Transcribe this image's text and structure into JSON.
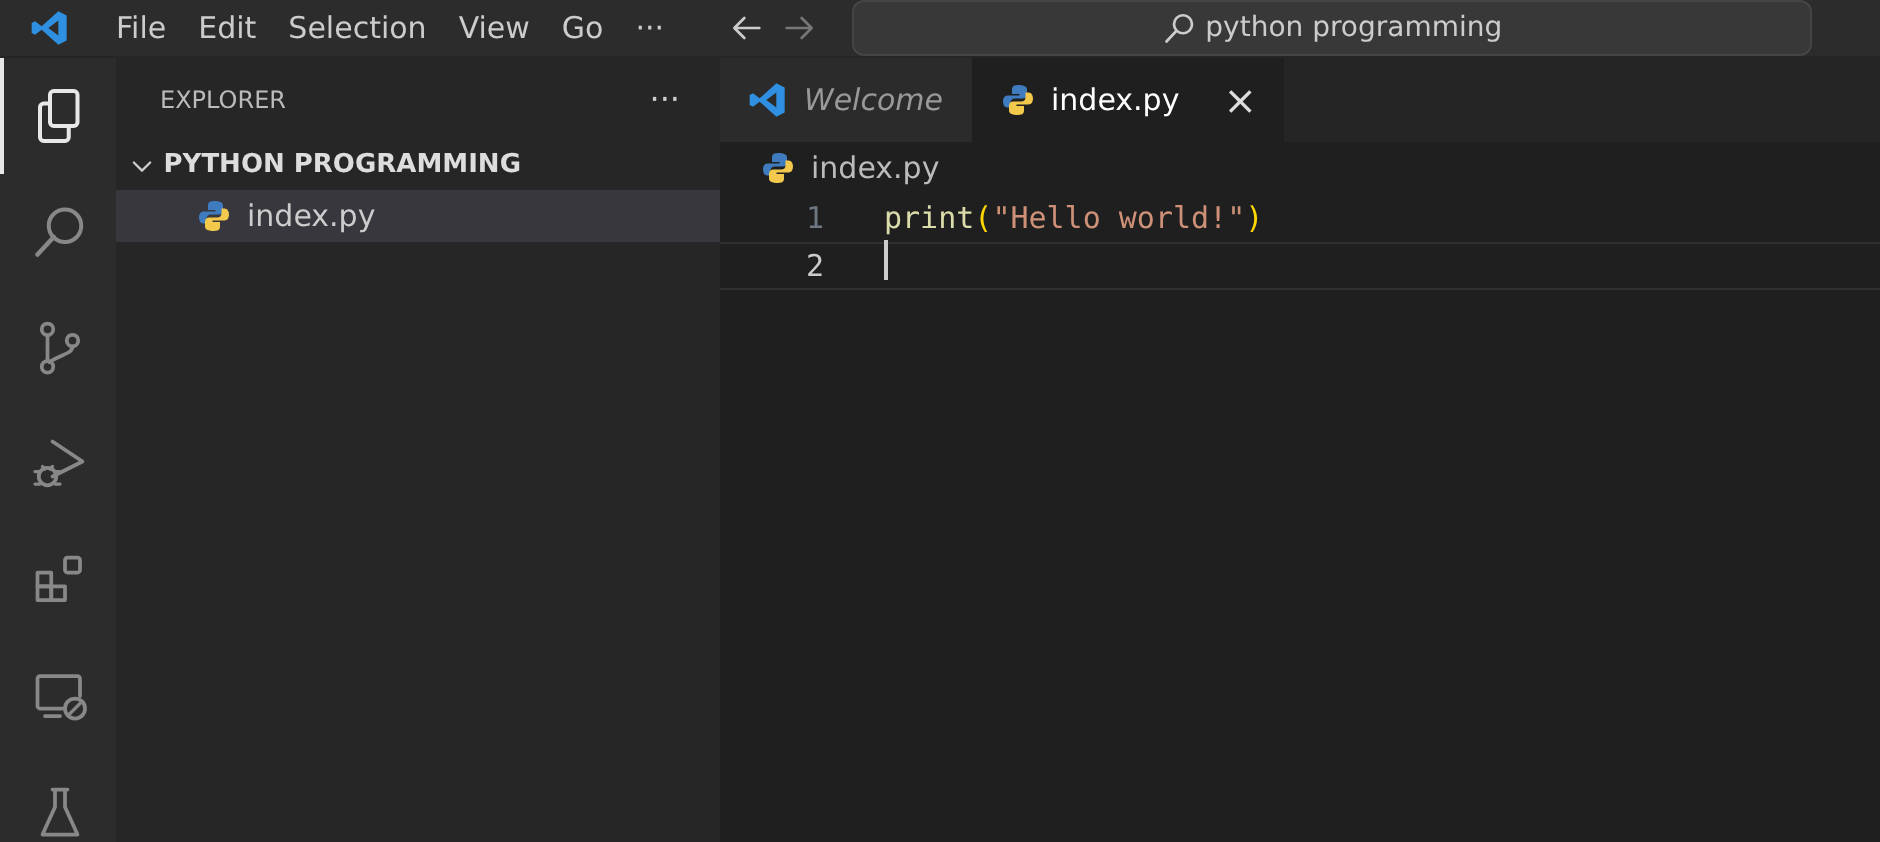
{
  "title_bar": {
    "menu": [
      {
        "label": "File"
      },
      {
        "label": "Edit"
      },
      {
        "label": "Selection"
      },
      {
        "label": "View"
      },
      {
        "label": "Go"
      },
      {
        "label": "···"
      }
    ],
    "search": {
      "value": "python programming"
    }
  },
  "activity_bar": [
    {
      "kind": "explorer",
      "selected": true
    },
    {
      "kind": "search",
      "selected": false
    },
    {
      "kind": "source-control",
      "selected": false
    },
    {
      "kind": "run-debug",
      "selected": false
    },
    {
      "kind": "extensions",
      "selected": false
    },
    {
      "kind": "remote",
      "selected": false
    },
    {
      "kind": "testing",
      "selected": false
    }
  ],
  "sidebar": {
    "title": "EXPLORER",
    "more": "···",
    "folder": {
      "label": "PYTHON PROGRAMMING",
      "expanded": true,
      "children": [
        {
          "label": "index.py",
          "kind": "python",
          "selected": true
        }
      ]
    }
  },
  "tabs": [
    {
      "label": "Welcome",
      "kind": "vscode",
      "preview": true,
      "selected": false
    },
    {
      "label": "index.py",
      "kind": "python",
      "preview": false,
      "selected": true,
      "close": "×"
    }
  ],
  "breadcrumb": {
    "label": "index.py",
    "kind": "python"
  },
  "code_lines": [
    {
      "number": "1",
      "current": false,
      "tokens": [
        {
          "kind": "function",
          "text": "print"
        },
        {
          "kind": "paren",
          "text": "("
        },
        {
          "kind": "string",
          "text": "\"Hello world!\""
        },
        {
          "kind": "paren",
          "text": ")"
        }
      ]
    },
    {
      "number": "2",
      "current": true
    }
  ]
}
